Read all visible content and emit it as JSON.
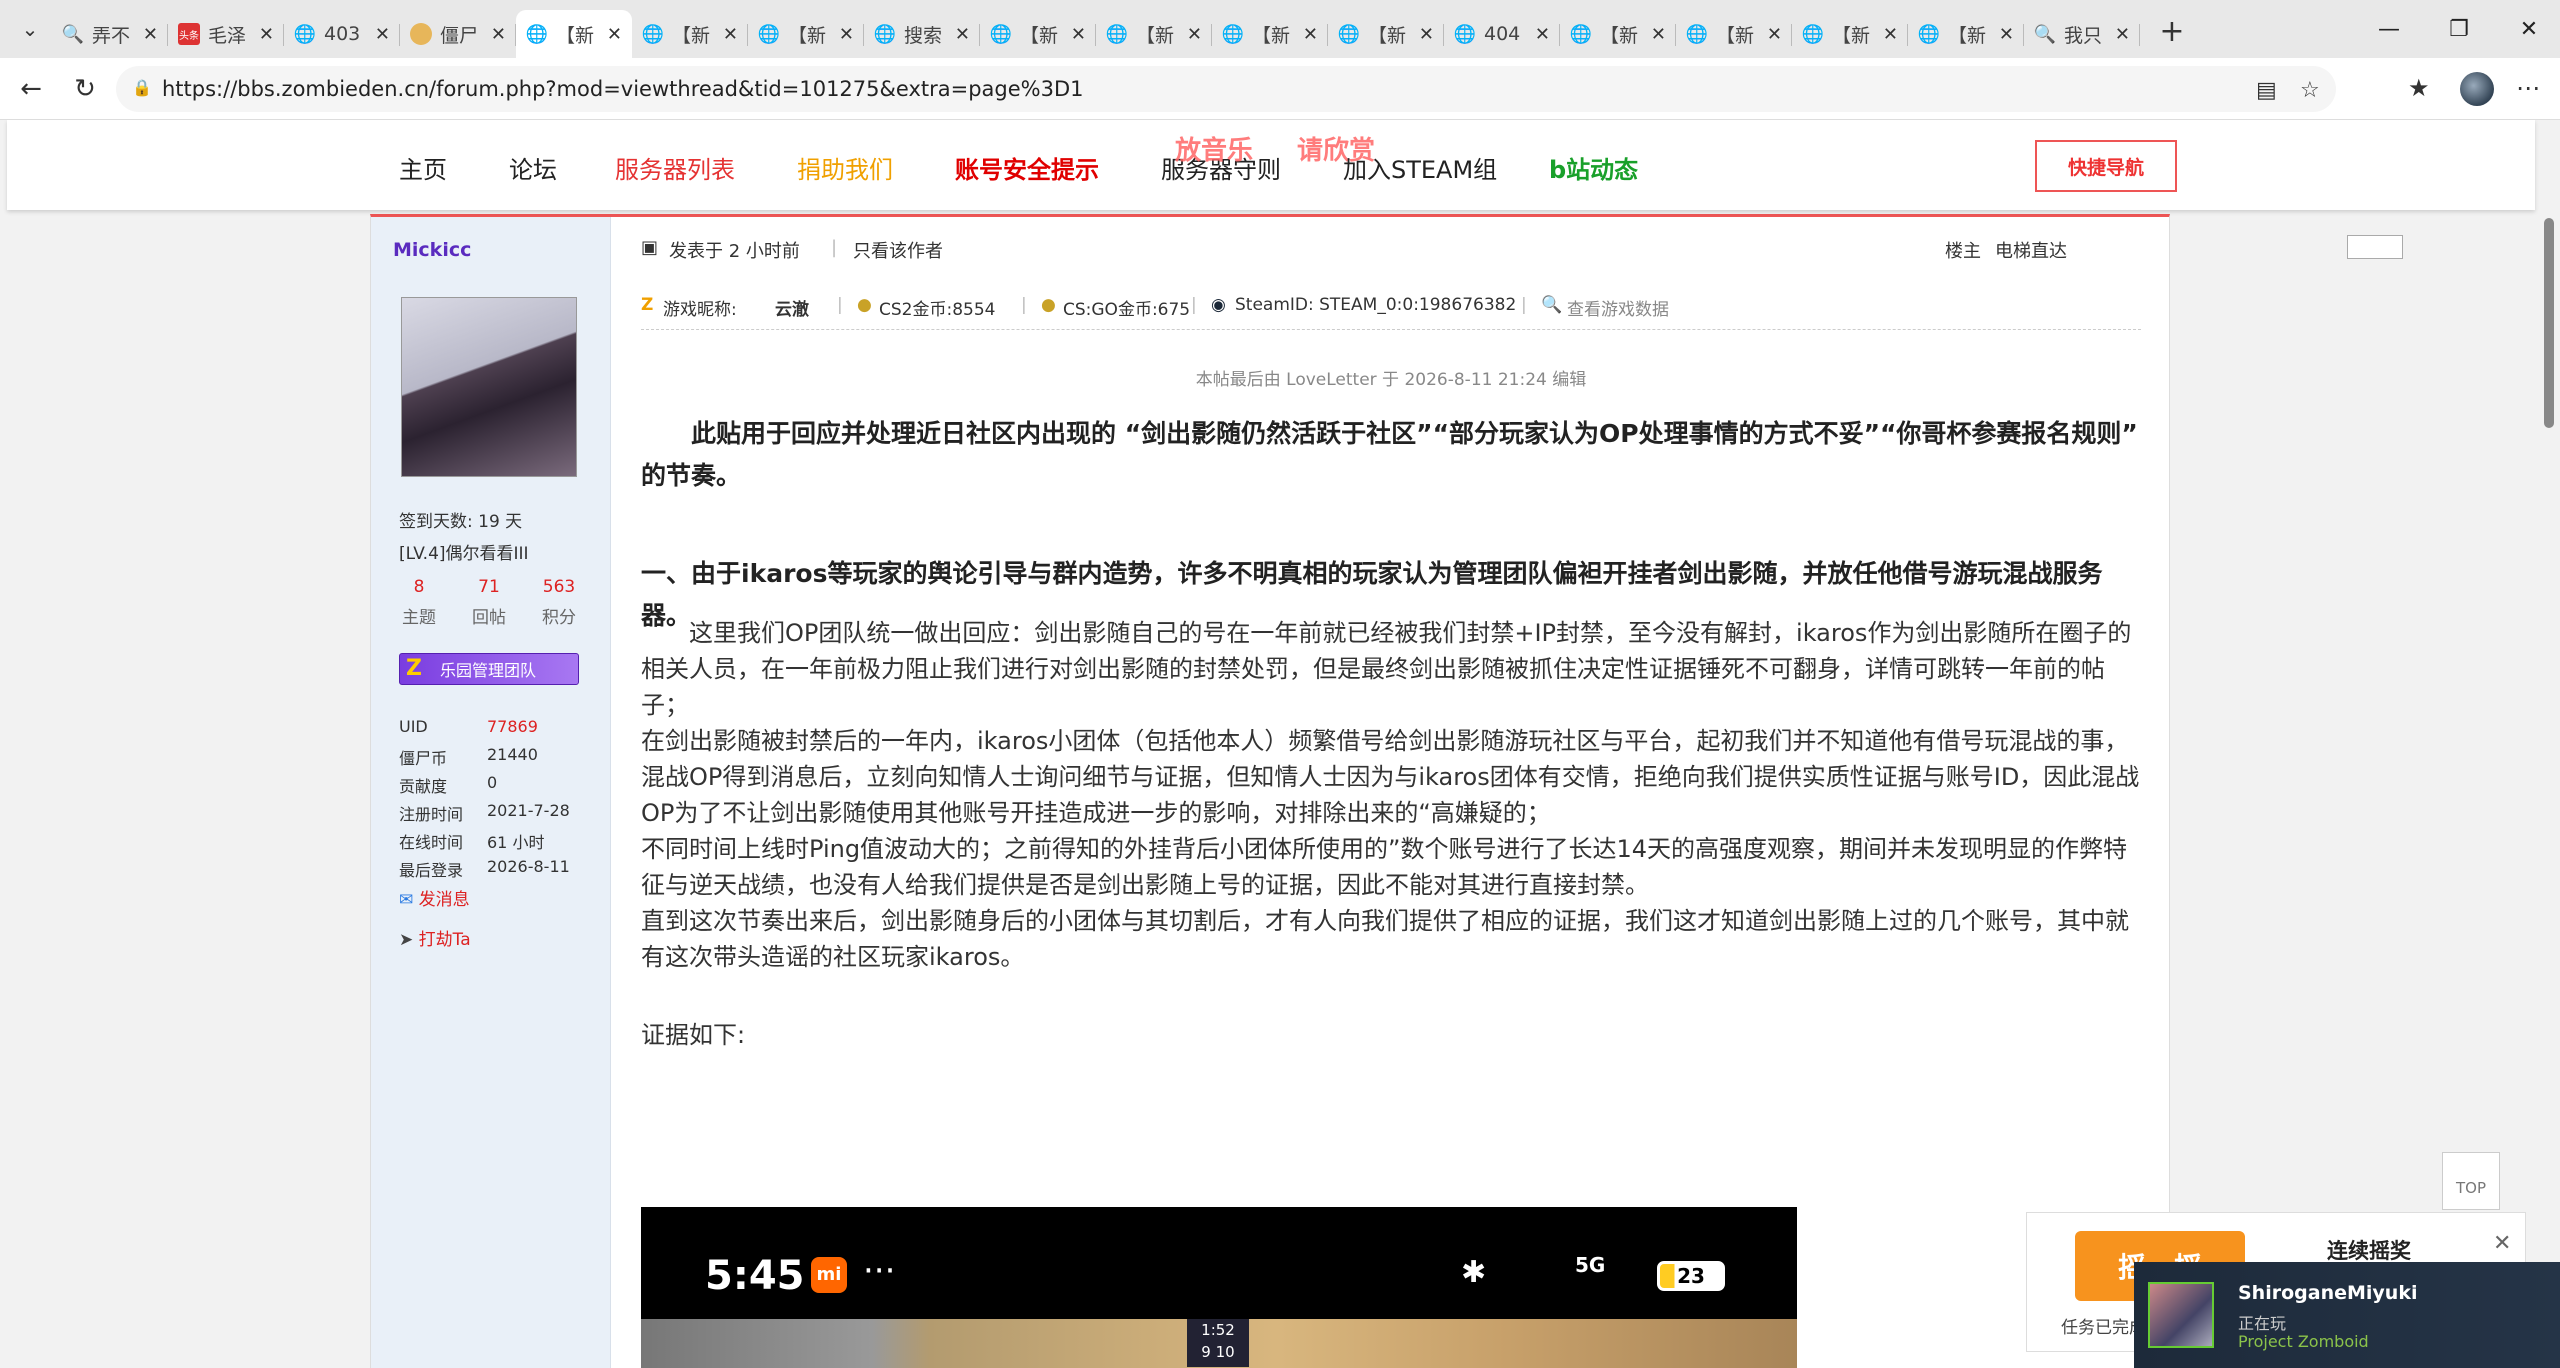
{
  "browser": {
    "tabs": [
      {
        "icon": "search-icon",
        "title": "弄不"
      },
      {
        "icon": "news-icon",
        "badge": "头条",
        "title": "毛泽"
      },
      {
        "icon": "globe-icon",
        "title": "403"
      },
      {
        "icon": "site-icon",
        "title": "僵尸"
      },
      {
        "icon": "globe-icon",
        "title": "【新",
        "active": true
      },
      {
        "icon": "globe-icon",
        "title": "【新"
      },
      {
        "icon": "globe-icon",
        "title": "【新"
      },
      {
        "icon": "globe-icon",
        "title": "搜索"
      },
      {
        "icon": "globe-icon",
        "title": "【新"
      },
      {
        "icon": "globe-icon",
        "title": "【新"
      },
      {
        "icon": "globe-icon",
        "title": "【新"
      },
      {
        "icon": "globe-icon",
        "title": "【新"
      },
      {
        "icon": "globe-icon",
        "title": "404"
      },
      {
        "icon": "globe-icon",
        "title": "【新"
      },
      {
        "icon": "globe-icon",
        "title": "【新"
      },
      {
        "icon": "globe-icon",
        "title": "【新"
      },
      {
        "icon": "globe-icon",
        "title": "【新"
      },
      {
        "icon": "search-icon",
        "title": "我只"
      }
    ],
    "url": "https://bbs.zombieden.cn/forum.php?mod=viewthread&tid=101275&extra=page%3D1"
  },
  "site_nav": {
    "items": [
      {
        "label": "主页",
        "color": "#222222"
      },
      {
        "label": "论坛",
        "color": "#222222"
      },
      {
        "label": "服务器列表",
        "color": "#e53333"
      },
      {
        "label": "捐助我们",
        "color": "#f0a000"
      },
      {
        "label": "账号安全提示",
        "color": "#e00000"
      },
      {
        "label": "服务器守则",
        "color": "#222222"
      },
      {
        "label": "加入STEAM组",
        "color": "#222222"
      },
      {
        "label": "b站动态",
        "color": "#19a02a"
      }
    ],
    "hot_badges": [
      "放音乐",
      "请欣赏"
    ],
    "quick_nav": "快捷导航"
  },
  "author": {
    "name": "Mickicc",
    "checkin": "签到天数: 19 天",
    "level": "[LV.4]偶尔看看III",
    "stats": [
      {
        "value": "8",
        "label": "主题"
      },
      {
        "value": "71",
        "label": "回帖"
      },
      {
        "value": "563",
        "label": "积分"
      }
    ],
    "group_badge": "乐园管理团队",
    "info": [
      {
        "key": "UID",
        "value": "77869"
      },
      {
        "key": "僵尸币",
        "value": "21440"
      },
      {
        "key": "贡献度",
        "value": "0"
      },
      {
        "key": "注册时间",
        "value": "2021-7-28"
      },
      {
        "key": "在线时间",
        "value": "61 小时"
      },
      {
        "key": "最后登录",
        "value": "2026-8-11"
      }
    ],
    "actions": {
      "message": "发消息",
      "rob": "打劫Ta"
    }
  },
  "post": {
    "posted": "发表于 2 小时前",
    "only_author": "只看该作者",
    "floor": "楼主",
    "elevator": "电梯直达",
    "game_info": {
      "nick_label": "游戏昵称:",
      "nick": "云澈",
      "cs2": "CS2金币:8554",
      "csgo": "CS:GO金币:675",
      "steam": "SteamID: STEAM_0:0:198676382",
      "view": "查看游戏数据"
    },
    "edited": "本帖最后由 LoveLetter 于 2026-8-11 21:24 编辑",
    "intro": "此贴用于回应并处理近日社区内出现的 “剑出影随仍然活跃于社区”“部分玩家认为OP处理事情的方式不妥”“你哥杯参赛报名规则” 的节奏。",
    "section1": "一、由于ikaros等玩家的舆论引导与群内造势，许多不明真相的玩家认为管理团队偏袒开挂者剑出影随，并放任他借号游玩混战服务器。",
    "p1": "这里我们OP团队统一做出回应：剑出影随自己的号在一年前就已经被我们封禁+IP封禁，至今没有解封，ikaros作为剑出影随所在圈子的相关人员，在一年前极力阻止我们进行对剑出影随的封禁处罚，但是最终剑出影随被抓住决定性证据锤死不可翻身，详情可跳转一年前的帖子；",
    "p2": "在剑出影随被封禁后的一年内，ikaros小团体（包括他本人）频繁借号给剑出影随游玩社区与平台，起初我们并不知道他有借号玩混战的事，混战OP得到消息后，立刻向知情人士询问细节与证据，但知情人士因为与ikaros团体有交情，拒绝向我们提供实质性证据与账号ID，因此混战OP为了不让剑出影随使用其他账号开挂造成进一步的影响，对排除出来的“高嫌疑的；",
    "p3": "不同时间上线时Ping值波动大的；之前得知的外挂背后小团体所使用的”数个账号进行了长达14天的高强度观察，期间并未发现明显的作弊特征与逆天战绩，也没有人给我们提供是否是剑出影随上号的证据，因此不能对其进行直接封禁。",
    "p4": "直到这次节奏出来后，剑出影随身后的小团体与其切割后，才有人向我们提供了相应的证据，我们这才知道剑出影随上过的几个账号，其中就有这次带头造谣的社区玩家ikaros。",
    "evidence": "证据如下:",
    "screenshot": {
      "time": "5:45",
      "mi": "mi",
      "dots": "···",
      "net": "5G",
      "battery": "23",
      "round_time": "1:52",
      "score_a": "9",
      "score_b": "10"
    }
  },
  "widgets": {
    "totop": "TOP",
    "shake_button": "摇一摇",
    "shake_title": "连续摇奖",
    "shake_done": "任务已完成",
    "steam_user": "ShiroganeMiyuki",
    "steam_status": "正在玩",
    "steam_game": "Project Zomboid"
  }
}
